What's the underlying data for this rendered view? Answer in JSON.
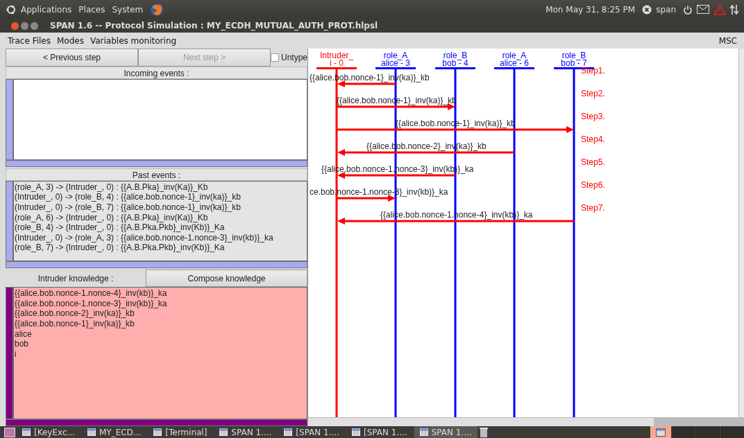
{
  "top_panel": {
    "menus": [
      "Applications",
      "Places",
      "System"
    ],
    "clock": "Mon May 31,  8:25 PM",
    "user": "span"
  },
  "window": {
    "title": "SPAN 1.6 -- Protocol Simulation : MY_ECDH_MUTUAL_AUTH_PROT.hlpsl"
  },
  "menubar": {
    "items": [
      "Trace Files",
      "Modes",
      "Variables monitoring"
    ],
    "right_label": "MSC"
  },
  "controls": {
    "previous": {
      "label": "< Previous step",
      "disabled": false
    },
    "next": {
      "label": "Next step >",
      "disabled": true
    },
    "untype": {
      "label": "Untype",
      "checked": false
    }
  },
  "incoming_events": {
    "title": "Incoming events :"
  },
  "past_events": {
    "title": "Past events :",
    "items": [
      "(role_A, 3) -> (Intruder_, 0) : {{A.B.Pka}_inv(Ka)}_Kb",
      "(Intruder_, 0) -> (role_B, 4) : {{alice.bob.nonce-1}_inv(ka)}_kb",
      "(Intruder_, 0) -> (role_B, 7) : {{alice.bob.nonce-1}_inv(ka)}_kb",
      "(role_A, 6) -> (Intruder_, 0) : {{A.B.Pka}_inv(Ka)}_Kb",
      "(role_B, 4) -> (Intruder_, 0) : {{A.B.Pka.Pkb}_inv(Kb)}_Ka",
      "(Intruder_, 0) -> (role_A, 3) : {{alice.bob.nonce-1.nonce-3}_inv(kb)}_ka",
      "(role_B, 7) -> (Intruder_, 0) : {{A.B.Pka.Pkb}_inv(Kb)}_Ka"
    ]
  },
  "intruder_knowledge": {
    "title": "Intruder knowledge :",
    "compose_button": "Compose knowledge",
    "items": [
      "{{alice.bob.nonce-1.nonce-4}_inv(kb)}_ka",
      "{{alice.bob.nonce-1.nonce-3}_inv(kb)}_ka",
      "{{alice.bob.nonce-2}_inv(ka)}_kb",
      "{{alice.bob.nonce-1}_inv(ka)}_kb",
      "alice",
      "bob",
      "i"
    ]
  },
  "msc": {
    "lifelines": [
      {
        "role": "Intruder_",
        "instance": "i - 0",
        "kind": "intruder"
      },
      {
        "role": "role_A",
        "instance": "alice - 3",
        "kind": "agent"
      },
      {
        "role": "role_B",
        "instance": "bob - 4",
        "kind": "agent"
      },
      {
        "role": "role_A",
        "instance": "alice - 6",
        "kind": "agent"
      },
      {
        "role": "role_B",
        "instance": "bob - 7",
        "kind": "agent"
      }
    ],
    "messages": [
      {
        "step": "Step1.",
        "label": "{{alice.bob.nonce-1}_inv(ka)}_kb"
      },
      {
        "step": "Step2.",
        "label": "{{alice.bob.nonce-1}_inv(ka)}_kb"
      },
      {
        "step": "Step3.",
        "label": "{{alice.bob.nonce-1}_inv(ka)}_kb"
      },
      {
        "step": "Step4.",
        "label": "{{alice.bob.nonce-2}_inv(ka)}_kb"
      },
      {
        "step": "Step5.",
        "label": "{{alice.bob.nonce-1.nonce-3}_inv(kb)}_ka"
      },
      {
        "step": "Step6.",
        "label": "ce.bob.nonce-1.nonce-3}_inv(kb)}_ka"
      },
      {
        "step": "Step7.",
        "label": "{{alice.bob.nonce-1.nonce-4}_inv(kb)}_ka"
      }
    ]
  },
  "taskbar": {
    "items": [
      {
        "label": "[KeyExc...",
        "selected": false
      },
      {
        "label": "MY_ECD...",
        "selected": false
      },
      {
        "label": "[Terminal]",
        "selected": false
      },
      {
        "label": "SPAN 1....",
        "selected": false
      },
      {
        "label": "[SPAN 1....",
        "selected": false
      },
      {
        "label": "[SPAN 1....",
        "selected": false
      },
      {
        "label": "SPAN 1....",
        "selected": true
      }
    ]
  }
}
